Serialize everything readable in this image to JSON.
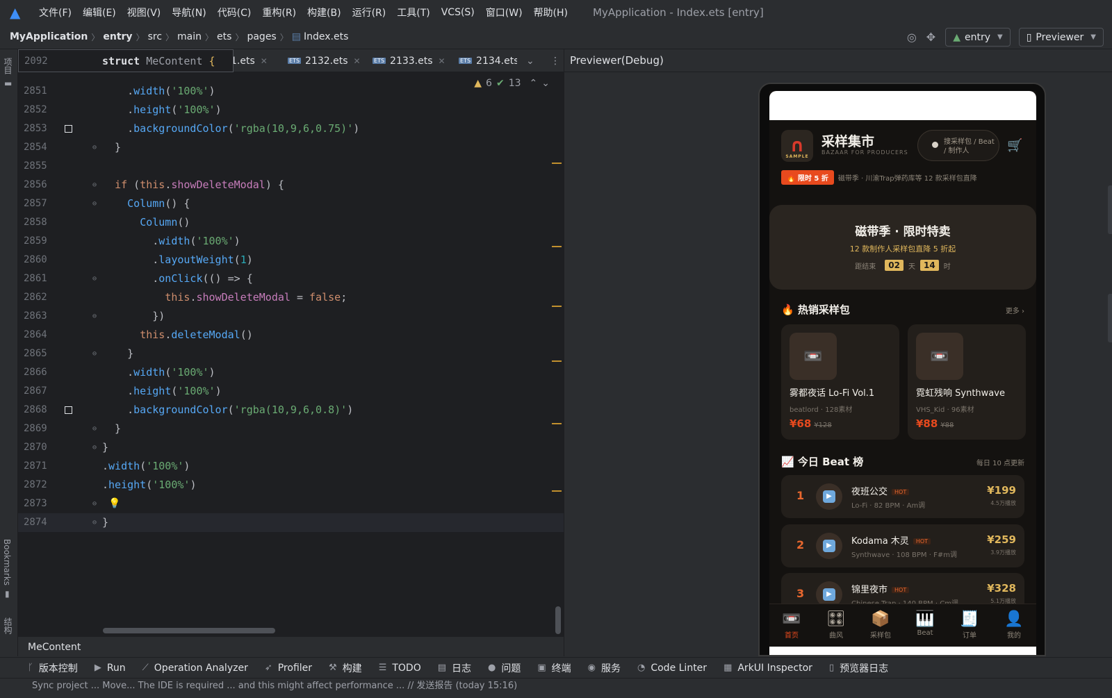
{
  "menu": {
    "items": [
      "文件(F)",
      "编辑(E)",
      "视图(V)",
      "导航(N)",
      "代码(C)",
      "重构(R)",
      "构建(B)",
      "运行(R)",
      "工具(T)",
      "VCS(S)",
      "窗口(W)",
      "帮助(H)"
    ],
    "title": "MyApplication - Index.ets [entry]"
  },
  "breadcrumb": [
    "MyApplication",
    "entry",
    "src",
    "main",
    "ets",
    "pages",
    "Index.ets"
  ],
  "toolbar": {
    "module": "entry",
    "run_config": "Previewer"
  },
  "tabs": [
    "1.ets",
    "2132.ets",
    "2133.ets",
    "2134.ets"
  ],
  "sticky": {
    "line": "2092",
    "code": "struct MeContent {"
  },
  "indicator": {
    "warnings": "6",
    "checks": "13"
  },
  "code_lines": [
    {
      "n": "2851",
      "t": "    .width('100%')"
    },
    {
      "n": "2852",
      "t": "    .height('100%')"
    },
    {
      "n": "2853",
      "t": "    .backgroundColor('rgba(10,9,6,0.75)')"
    },
    {
      "n": "2854",
      "t": "  }"
    },
    {
      "n": "2855",
      "t": ""
    },
    {
      "n": "2856",
      "t": "  if (this.showDeleteModal) {"
    },
    {
      "n": "2857",
      "t": "    Column() {"
    },
    {
      "n": "2858",
      "t": "      Column()"
    },
    {
      "n": "2859",
      "t": "        .width('100%')"
    },
    {
      "n": "2860",
      "t": "        .layoutWeight(1)"
    },
    {
      "n": "2861",
      "t": "        .onClick(() => {"
    },
    {
      "n": "2862",
      "t": "          this.showDeleteModal = false;"
    },
    {
      "n": "2863",
      "t": "        })"
    },
    {
      "n": "2864",
      "t": "      this.deleteModal()"
    },
    {
      "n": "2865",
      "t": "    }"
    },
    {
      "n": "2866",
      "t": "    .width('100%')"
    },
    {
      "n": "2867",
      "t": "    .height('100%')"
    },
    {
      "n": "2868",
      "t": "    .backgroundColor('rgba(10,9,6,0.8)')"
    },
    {
      "n": "2869",
      "t": "  }"
    },
    {
      "n": "2870",
      "t": "}"
    },
    {
      "n": "2871",
      "t": ".width('100%')"
    },
    {
      "n": "2872",
      "t": ".height('100%')"
    },
    {
      "n": "2873",
      "t": ""
    },
    {
      "n": "2874",
      "t": "}"
    }
  ],
  "structure_crumb": "MeContent",
  "left_panel": {
    "project": "项目",
    "bookmarks": "Bookmarks",
    "structure": "结构"
  },
  "previewer": {
    "title": "Previewer(Debug)",
    "app": {
      "brand": "采样集市",
      "brand_sub": "BAZAAR FOR PRODUCERS",
      "logo_text": "SAMPLE",
      "search_placeholder": "搜采样包 / Beat / 制作人",
      "promo_tag": "🔥 限时 5 折",
      "promo_text": "磁带季 · 川渝Trap弹药库等 12 款采样包直降",
      "banner": {
        "title": "磁带季 · 限时特卖",
        "subtitle": "12 款制作人采样包直降 5 折起",
        "prefix": "距结束",
        "days": "02",
        "day_label": "天",
        "hours": "14",
        "hour_label": "时"
      },
      "hot_section": {
        "title": "🔥 热销采样包",
        "more": "更多 ›"
      },
      "packs": [
        {
          "title": "雾都夜话 Lo-Fi Vol.1",
          "meta": "beatlord · 128素材",
          "price": "¥68",
          "orig": "¥128"
        },
        {
          "title": "霓虹残响 Synthwave",
          "meta": "VHS_Kid · 96素材",
          "price": "¥88",
          "orig": "¥88"
        }
      ],
      "beat_section": {
        "title": "📈 今日 Beat 榜",
        "more": "每日 10 点更新"
      },
      "beats": [
        {
          "rank": "1",
          "name": "夜班公交",
          "hot": "HOT",
          "meta": "Lo-Fi · 82 BPM · Am调",
          "price": "¥199",
          "plays": "4.5万播放"
        },
        {
          "rank": "2",
          "name": "Kodama 木灵",
          "hot": "HOT",
          "meta": "Synthwave · 108 BPM · F#m调",
          "price": "¥259",
          "plays": "3.9万播放"
        },
        {
          "rank": "3",
          "name": "锦里夜市",
          "hot": "HOT",
          "meta": "Chinese Trap · 140 BPM · Cm调",
          "price": "¥328",
          "plays": "5.1万播放"
        }
      ],
      "nav": [
        "首页",
        "曲风",
        "采样包",
        "Beat",
        "订单",
        "我的"
      ]
    }
  },
  "tools": [
    "版本控制",
    "Run",
    "Operation Analyzer",
    "Profiler",
    "构建",
    "TODO",
    "日志",
    "问题",
    "终端",
    "服务",
    "Code Linter",
    "ArkUI Inspector",
    "预览器日志"
  ],
  "status_line": "Sync project ... Move... The IDE is required ... and this might affect performance ... // 发送报告 (today 15:16)",
  "colors": {
    "accent": "#3e8ef7",
    "brand_red": "#e84a1e",
    "gold": "#e0b75c"
  }
}
